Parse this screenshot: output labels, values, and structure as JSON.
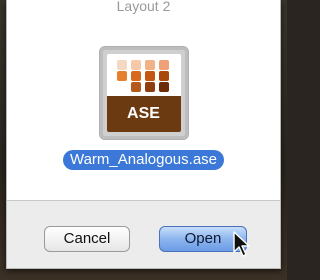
{
  "dialog": {
    "title": "Layout 2",
    "file": {
      "icon": "ase-file-icon",
      "icon_badge": "ASE",
      "name": "Warm_Analogous.ase",
      "swatch_colors": [
        [
          "#f4d9c2",
          "#f7c9a8",
          "#f1b287",
          "#eea076"
        ],
        [
          "#e6802e",
          "#d86a1e",
          "#c4560f",
          "#a8480c"
        ],
        [
          "#ffffff",
          "#b65a1b",
          "#8e3f0d",
          "#6b2c06"
        ]
      ]
    },
    "buttons": {
      "cancel_label": "Cancel",
      "open_label": "Open"
    }
  },
  "colors": {
    "selection": "#3b78d8",
    "open_button": "#8db6ef",
    "ase_band": "#6b3a10"
  }
}
